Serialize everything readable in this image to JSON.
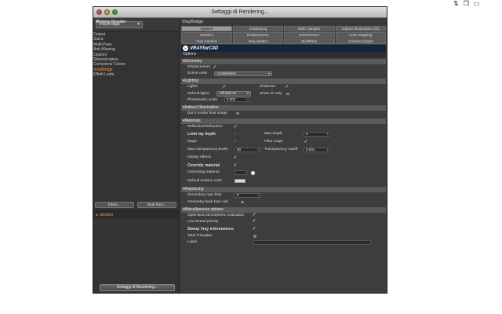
{
  "menubar_icons": [
    "up-down-arrows-icon",
    "copy-icon",
    "window-icon"
  ],
  "window": {
    "title": "Settaggi di Rendering..."
  },
  "left": {
    "renderer_label": "Motore Render",
    "renderer_value": "VrayBridge",
    "items": [
      {
        "label": "Output",
        "checked": true,
        "active": false
      },
      {
        "label": "Salva",
        "checked": true,
        "active": false
      },
      {
        "label": "Multi-Pass",
        "checked": false,
        "active": false
      },
      {
        "label": "Anti-Aliasing",
        "checked": false,
        "active": false
      },
      {
        "label": "Opzioni",
        "checked": false,
        "active": false
      },
      {
        "label": "Stereoscopico",
        "checked": false,
        "active": false
      },
      {
        "label": "Correzione Colore",
        "checked": false,
        "active": false
      },
      {
        "label": "VrayBridge",
        "checked": false,
        "active": true
      },
      {
        "label": "Effetti Lente",
        "checked": true,
        "active": false
      }
    ],
    "effect_button": "Effetto...",
    "multipass_button": "Multi-Pass...",
    "setting_name": "Stefano",
    "bottom_button": "Settaggi di Rendering..."
  },
  "right": {
    "panel_title": "VrayBridge",
    "tabs": [
      {
        "label": "Options",
        "active": true
      },
      {
        "label": "Antialiasing",
        "active": false
      },
      {
        "label": "DMC Sampler",
        "active": false
      },
      {
        "label": "Indirect Illumination (GI)",
        "active": false
      },
      {
        "label": "Caustics",
        "active": false
      },
      {
        "label": "Displacement",
        "active": false
      },
      {
        "label": "Environment",
        "active": false
      },
      {
        "label": "Color Mapping",
        "active": false
      },
      {
        "label": "Vray Camera",
        "active": false
      },
      {
        "label": "Vray system",
        "active": false
      },
      {
        "label": "MultiPass",
        "active": false
      },
      {
        "label": "Camera Clipper",
        "active": false
      }
    ],
    "logo_text": "VRAYforC4D",
    "options_header": "Options",
    "geometry": {
      "header": "▾Geometry",
      "displacement_label": "Displacement",
      "scene_units_label": "Scene units",
      "scene_units_value": "Centimeters"
    },
    "lighting": {
      "header": "▾Lighting",
      "lights_label": "Lights",
      "shadows_label": "Shadows",
      "default_lights_label": "Default lights",
      "default_lights_value": "Off with GI",
      "show_gi_only_label": "Show GI only",
      "photometric_scale_label": "Photometric scale",
      "photometric_scale_value": "0.002"
    },
    "indirect": {
      "header": "▾Indirect Illumination",
      "dont_render_label": "Don't render final image"
    },
    "materials": {
      "header": "▾Materials",
      "reflection_label": "Reflection/Refraction",
      "limit_ray_depth_label": "Limit ray depth",
      "max_depth_label": "Max depth",
      "max_depth_value": "5",
      "maps_label": "Maps",
      "filter_maps_label": "Filter maps",
      "max_transparency_label": "Max transparency levels",
      "max_transparency_value": "50",
      "transparency_cutoff_label": "Transparency cutoff",
      "transparency_cutoff_value": "0.001",
      "glossy_label": "Glossy effects",
      "override_label": "Override material",
      "overriding_label": "Overriding material",
      "default_surface_label": "Default surface color",
      "default_surface_color": "#d8d8d8"
    },
    "raytracing": {
      "header": "▾Raytracing",
      "secondary_bias_label": "Secondary rays bias",
      "secondary_bias_value": "0",
      "backface_label": "Geometry back face cull"
    },
    "misc": {
      "header": "▾Miscellaneous options",
      "atmospheric_label": "Optimised atmospheric evaluation",
      "low_priority_label": "Low thread priority",
      "stamp_label": "Stamp Vray informations",
      "total_triangles_label": "Total Triangles",
      "label_label": "Label"
    }
  },
  "colors": {
    "accent_orange": "#f0a030",
    "logo_bg": "#13243f"
  }
}
